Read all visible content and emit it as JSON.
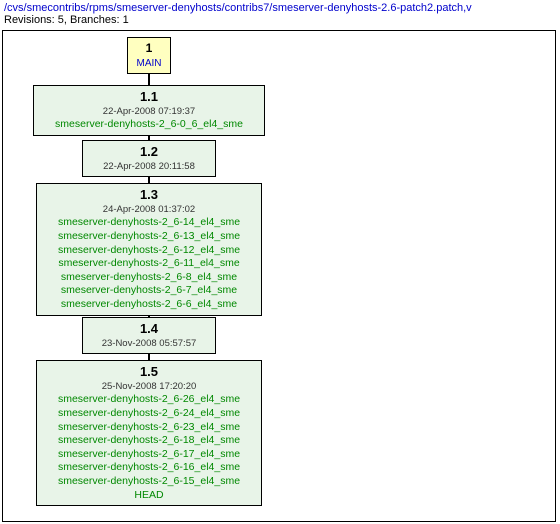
{
  "header": {
    "path": "/cvs/smecontribs/rpms/smeserver-denyhosts/contribs7/smeserver-denyhosts-2.6-patch2.patch,v",
    "info": "Revisions: 5, Branches: 1"
  },
  "main": {
    "num": "1",
    "label": "MAIN"
  },
  "rev11": {
    "num": "1.1",
    "date": "22-Apr-2008 07:19:37",
    "tags": [
      "smeserver-denyhosts-2_6-0_6_el4_sme"
    ]
  },
  "rev12": {
    "num": "1.2",
    "date": "22-Apr-2008 20:11:58",
    "tags": []
  },
  "rev13": {
    "num": "1.3",
    "date": "24-Apr-2008 01:37:02",
    "tags": [
      "smeserver-denyhosts-2_6-14_el4_sme",
      "smeserver-denyhosts-2_6-13_el4_sme",
      "smeserver-denyhosts-2_6-12_el4_sme",
      "smeserver-denyhosts-2_6-11_el4_sme",
      "smeserver-denyhosts-2_6-8_el4_sme",
      "smeserver-denyhosts-2_6-7_el4_sme",
      "smeserver-denyhosts-2_6-6_el4_sme"
    ]
  },
  "rev14": {
    "num": "1.4",
    "date": "23-Nov-2008 05:57:57",
    "tags": []
  },
  "rev15": {
    "num": "1.5",
    "date": "25-Nov-2008 17:20:20",
    "tags": [
      "smeserver-denyhosts-2_6-26_el4_sme",
      "smeserver-denyhosts-2_6-24_el4_sme",
      "smeserver-denyhosts-2_6-23_el4_sme",
      "smeserver-denyhosts-2_6-18_el4_sme",
      "smeserver-denyhosts-2_6-17_el4_sme",
      "smeserver-denyhosts-2_6-16_el4_sme",
      "smeserver-denyhosts-2_6-15_el4_sme",
      "HEAD"
    ]
  }
}
